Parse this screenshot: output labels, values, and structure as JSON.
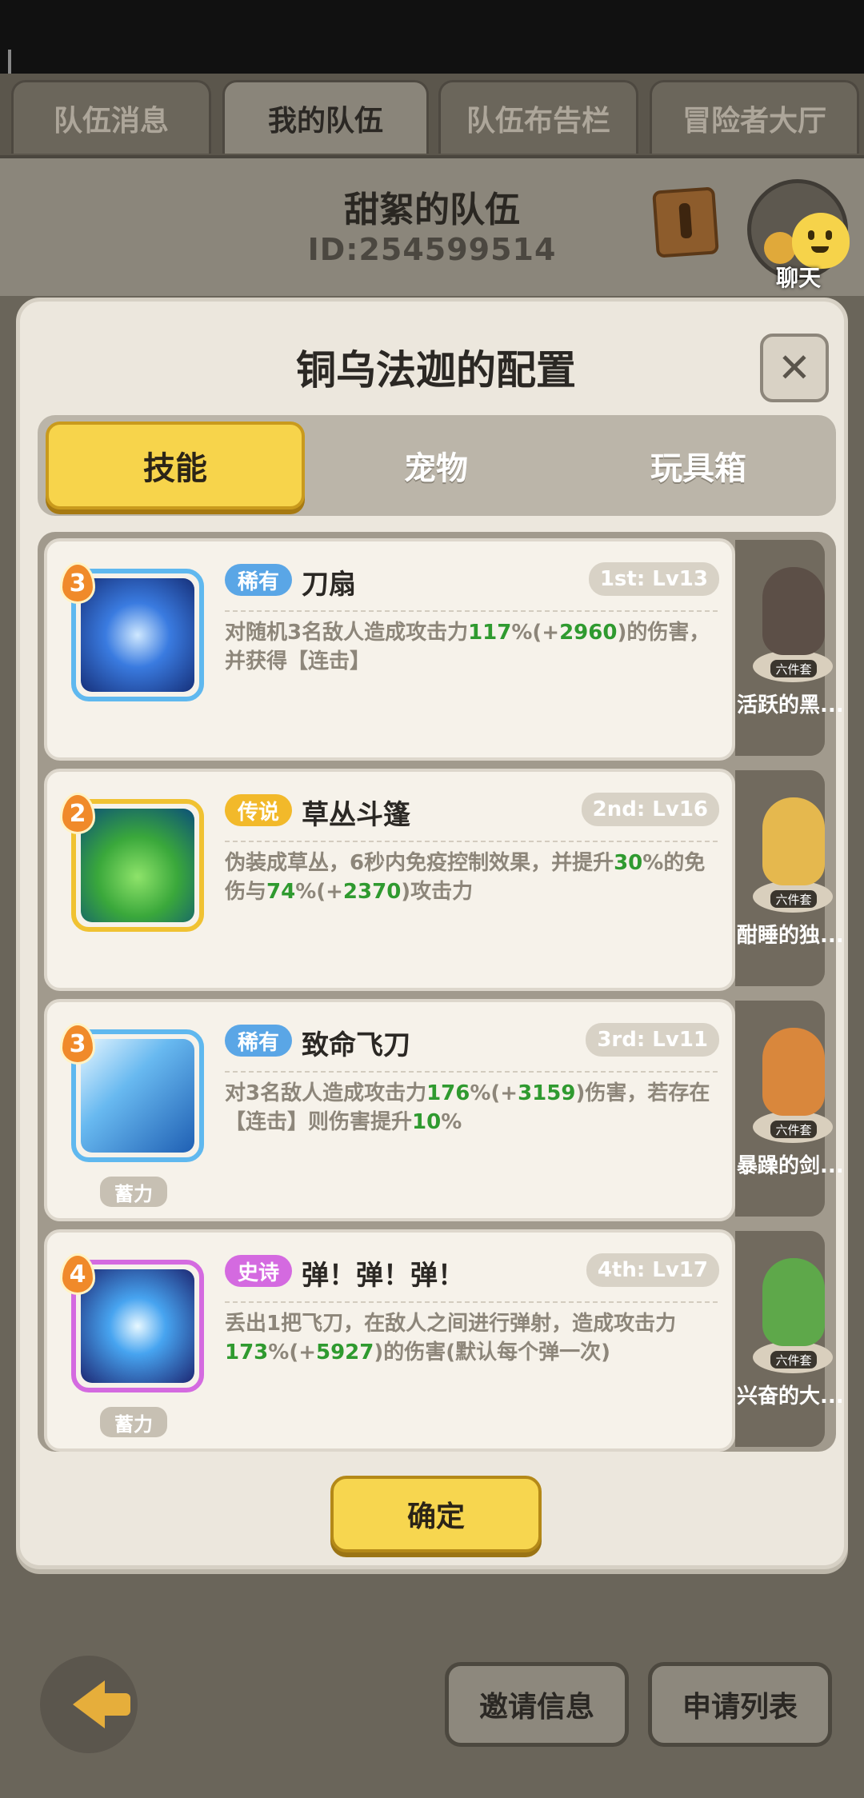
{
  "top_tabs": [
    "队伍消息",
    "我的队伍",
    "队伍布告栏",
    "冒险者大厅"
  ],
  "team": {
    "name": "甜絮的队伍",
    "id": "ID:254599514"
  },
  "chat_label": "聊天",
  "dialog": {
    "title": "铜乌法迦的配置",
    "tabs": [
      "技能",
      "宠物",
      "玩具箱"
    ],
    "confirm_label": "确定"
  },
  "skills": [
    {
      "level": "3",
      "rarity": "稀有",
      "rarity_color": "#5aa6e6",
      "name": "刀扇",
      "slot": "1st: Lv13",
      "desc_parts": [
        "对随机3名敌人造成攻击力",
        "117",
        "%(+",
        "2960",
        ")的伤害，并获得【连击】"
      ],
      "charge": "",
      "icon_theme": "blue-blade-fan",
      "side_name": "活跃的黑...",
      "side_set": "六件套"
    },
    {
      "level": "2",
      "rarity": "传说",
      "rarity_color": "#f2b92a",
      "name": "草丛斗篷",
      "slot": "2nd: Lv16",
      "desc_parts": [
        "伪装成草丛，6秒内免疫控制效果，并提升",
        "30",
        "%的免伤与",
        "74",
        "%(+",
        "2370",
        ")攻击力"
      ],
      "charge": "",
      "icon_theme": "green-bush",
      "side_name": "酣睡的独...",
      "side_set": "六件套"
    },
    {
      "level": "3",
      "rarity": "稀有",
      "rarity_color": "#5aa6e6",
      "name": "致命飞刀",
      "slot": "3rd: Lv11",
      "desc_parts": [
        "对3名敌人造成攻击力",
        "176",
        "%(+",
        "3159",
        ")伤害，若存在【连击】则伤害提升",
        "10",
        "%"
      ],
      "charge": "蓄力",
      "icon_theme": "blue-flying-knives",
      "side_name": "暴躁的剑...",
      "side_set": "六件套"
    },
    {
      "level": "4",
      "rarity": "史诗",
      "rarity_color": "#d46ae0",
      "name": "弹！弹！弹！",
      "slot": "4th: Lv17",
      "desc_parts": [
        "丢出1把飞刀，在敌人之间进行弹射，造成攻击力",
        "173",
        "%(+",
        "5927",
        ")的伤害(默认每个弹一次)"
      ],
      "charge": "蓄力",
      "icon_theme": "purple-bounce",
      "side_name": "兴奋的大...",
      "side_set": "六件套"
    }
  ],
  "bottom": {
    "invite": "邀请信息",
    "apply": "申请列表"
  }
}
